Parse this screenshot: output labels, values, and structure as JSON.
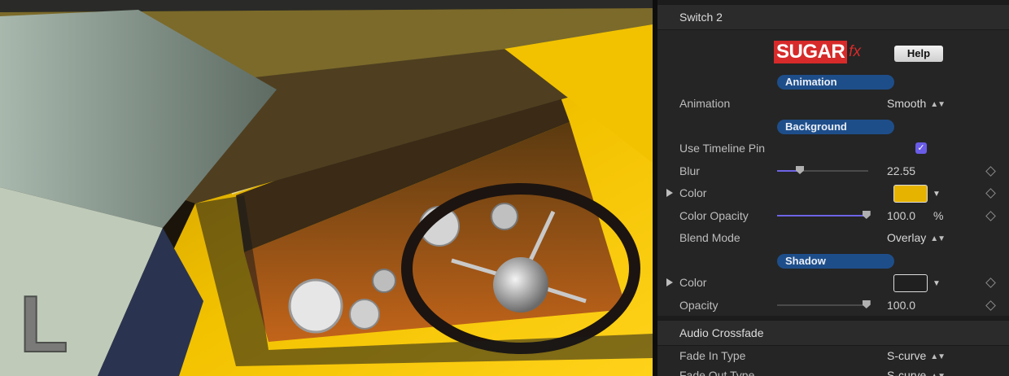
{
  "viewer": {
    "watermark_letter": "L"
  },
  "colors": {
    "accent_slider": "#6e64e6",
    "section_pill": "#1e4e8a",
    "brand_red": "#d72a2a",
    "background_color_swatch": "#e5b300",
    "shadow_color_swatch": "#202020"
  },
  "inspector": {
    "header": {
      "title": "Switch 2"
    },
    "logo": {
      "brand": "SUGAR",
      "suffix": "fx"
    },
    "help_button": "Help",
    "sections": {
      "animation": "Animation",
      "background": "Background",
      "shadow": "Shadow"
    },
    "rows": {
      "animation": {
        "label": "Animation",
        "value": "Smooth"
      },
      "use_timeline_pin": {
        "label": "Use Timeline Pin",
        "checked": true
      },
      "blur": {
        "label": "Blur",
        "value": "22.55",
        "slider_fraction": 0.25
      },
      "bg_color": {
        "label": "Color",
        "icon": "disclosure-triangle"
      },
      "color_opacity": {
        "label": "Color Opacity",
        "value": "100.0",
        "unit": "%",
        "slider_fraction": 0.98
      },
      "blend_mode": {
        "label": "Blend Mode",
        "value": "Overlay"
      },
      "shadow_color": {
        "label": "Color"
      },
      "opacity": {
        "label": "Opacity",
        "value": "100.0",
        "slider_fraction": 0.98
      }
    },
    "audio_crossfade": {
      "title": "Audio Crossfade",
      "fade_in": {
        "label": "Fade In Type",
        "value": "S-curve"
      },
      "fade_out": {
        "label": "Fade Out Type",
        "value": "S-curve"
      }
    }
  }
}
